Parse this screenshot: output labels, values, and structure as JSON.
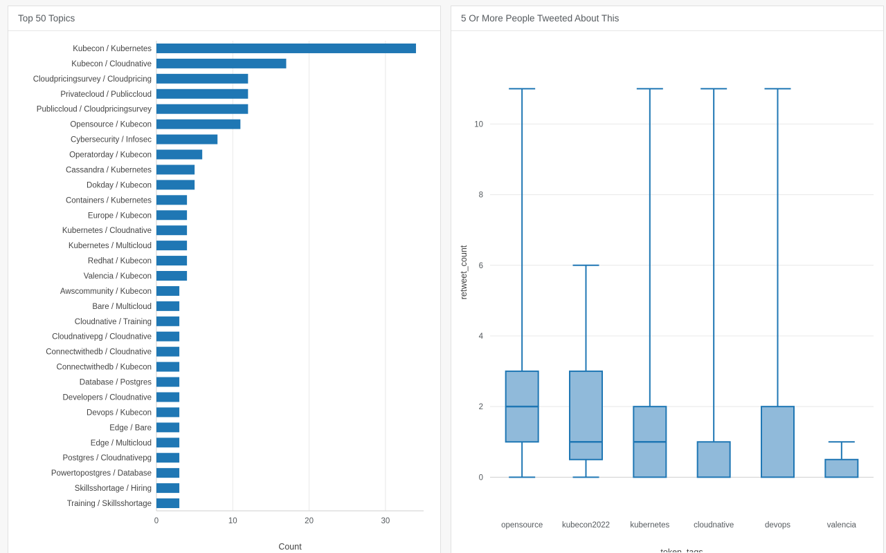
{
  "left_panel": {
    "title": "Top 50 Topics"
  },
  "right_panel": {
    "title": "5 Or More People Tweeted About This"
  },
  "chart_data": [
    {
      "type": "bar",
      "orientation": "horizontal",
      "title": "Top 50 Topics",
      "xlabel": "Count",
      "ylabel": "",
      "xlim": [
        0,
        35
      ],
      "xticks": [
        0,
        10,
        20,
        30
      ],
      "grid": true,
      "bar_color": "#1f77b4",
      "categories": [
        "Kubecon / Kubernetes",
        "Kubecon / Cloudnative",
        "Cloudpricingsurvey / Cloudpricing",
        "Privatecloud / Publiccloud",
        "Publiccloud / Cloudpricingsurvey",
        "Opensource / Kubecon",
        "Cybersecurity / Infosec",
        "Operatorday / Kubecon",
        "Cassandra / Kubernetes",
        "Dokday / Kubecon",
        "Containers / Kubernetes",
        "Europe / Kubecon",
        "Kubernetes / Cloudnative",
        "Kubernetes / Multicloud",
        "Redhat / Kubecon",
        "Valencia / Kubecon",
        "Awscommunity / Kubecon",
        "Bare / Multicloud",
        "Cloudnative / Training",
        "Cloudnativepg / Cloudnative",
        "Connectwithedb / Cloudnative",
        "Connectwithedb / Kubecon",
        "Database / Postgres",
        "Developers / Cloudnative",
        "Devops / Kubecon",
        "Edge / Bare",
        "Edge / Multicloud",
        "Postgres / Cloudnativepg",
        "Powertopostgres / Database",
        "Skillsshortage / Hiring",
        "Training / Skillsshortage"
      ],
      "values": [
        34,
        17,
        12,
        12,
        12,
        11,
        8,
        6,
        5,
        5,
        4,
        4,
        4,
        4,
        4,
        4,
        3,
        3,
        3,
        3,
        3,
        3,
        3,
        3,
        3,
        3,
        3,
        3,
        3,
        3,
        3
      ]
    },
    {
      "type": "boxplot",
      "title": "5 Or More People Tweeted About This",
      "xlabel": "token_tags",
      "ylabel": "retweet_count",
      "ylim": [
        -0.6,
        12.2
      ],
      "yticks": [
        0,
        2,
        4,
        6,
        8,
        10
      ],
      "grid": true,
      "box_fill": "#90bada",
      "box_stroke": "#1f77b4",
      "categories": [
        "opensource",
        "kubecon2022",
        "kubernetes",
        "cloudnative",
        "devops",
        "valencia"
      ],
      "boxes": [
        {
          "label": "opensource",
          "whisker_low": 0,
          "q1": 1,
          "median": 2,
          "q3": 3,
          "whisker_high": 11
        },
        {
          "label": "kubecon2022",
          "whisker_low": 0,
          "q1": 0.5,
          "median": 1,
          "q3": 3,
          "whisker_high": 6
        },
        {
          "label": "kubernetes",
          "whisker_low": 0,
          "q1": 0,
          "median": 1,
          "q3": 2,
          "whisker_high": 11
        },
        {
          "label": "cloudnative",
          "whisker_low": 0,
          "q1": 0,
          "median": 0,
          "q3": 1,
          "whisker_high": 11
        },
        {
          "label": "devops",
          "whisker_low": 0,
          "q1": 0,
          "median": 0,
          "q3": 2,
          "whisker_high": 11
        },
        {
          "label": "valencia",
          "whisker_low": 0,
          "q1": 0,
          "median": 0,
          "q3": 0.5,
          "whisker_high": 1
        }
      ]
    }
  ]
}
